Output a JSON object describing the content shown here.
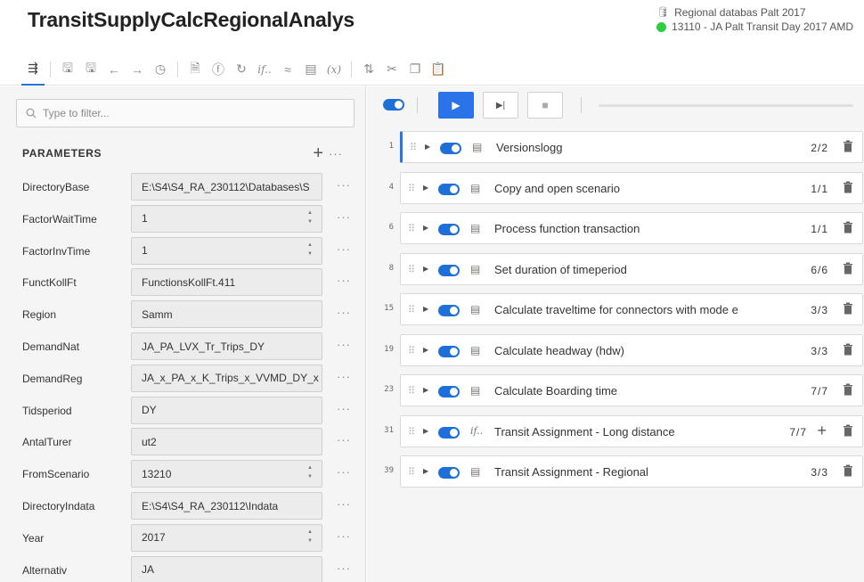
{
  "app": {
    "title": "TransitSupplyCalcRegionalAnalys",
    "database_label": "Regional databas Palt 2017",
    "scenario_label": "13110 - JA Palt Transit Day 2017 AMD",
    "scenario_status_color": "#2ecc40"
  },
  "toolbar": {
    "items": [
      {
        "name": "parameters-tab-icon",
        "glyph": "⇶"
      },
      {
        "name": "save-icon",
        "glyph": "🖫"
      },
      {
        "name": "save-as-icon",
        "glyph": "🖫"
      },
      {
        "name": "undo-icon",
        "glyph": "←"
      },
      {
        "name": "redo-icon",
        "glyph": "→"
      },
      {
        "name": "history-icon",
        "glyph": "◷"
      },
      {
        "name": "document-icon",
        "glyph": "🗎"
      },
      {
        "name": "function-icon",
        "glyph": "ⓕ"
      },
      {
        "name": "refresh-icon",
        "glyph": "↻"
      },
      {
        "name": "conditional-icon",
        "glyph": "if.."
      },
      {
        "name": "loop-icon",
        "glyph": "≈"
      },
      {
        "name": "list-icon",
        "glyph": "▤"
      },
      {
        "name": "variable-icon",
        "glyph": "(x)"
      },
      {
        "name": "sort-icon",
        "glyph": "⇅"
      },
      {
        "name": "cut-icon",
        "glyph": "✂"
      },
      {
        "name": "copy-icon",
        "glyph": "❐"
      },
      {
        "name": "paste-icon",
        "glyph": "📋"
      }
    ]
  },
  "filter": {
    "placeholder": "Type to filter..."
  },
  "parameters": {
    "title": "PARAMETERS",
    "add_glyph": "+",
    "more_glyph": "···",
    "rows": [
      {
        "label": "DirectoryBase",
        "value": "E:\\S4\\S4_RA_230112\\Databases\\S",
        "spinner": false
      },
      {
        "label": "FactorWaitTime",
        "value": "1",
        "spinner": true
      },
      {
        "label": "FactorInvTime",
        "value": "1",
        "spinner": true
      },
      {
        "label": "FunctKollFt",
        "value": "FunctionsKollFt.411",
        "spinner": false
      },
      {
        "label": "Region",
        "value": "Samm",
        "spinner": false
      },
      {
        "label": "DemandNat",
        "value": "JA_PA_LVX_Tr_Trips_DY",
        "spinner": false
      },
      {
        "label": "DemandReg",
        "value": "JA_x_PA_x_K_Trips_x_VVMD_DY_x",
        "spinner": false
      },
      {
        "label": "Tidsperiod",
        "value": "DY",
        "spinner": false
      },
      {
        "label": "AntalTurer",
        "value": "ut2",
        "spinner": false
      },
      {
        "label": "FromScenario",
        "value": "13210",
        "spinner": true
      },
      {
        "label": "DirectoryIndata",
        "value": "E:\\S4\\S4_RA_230112\\Indata",
        "spinner": false
      },
      {
        "label": "Year",
        "value": "2017",
        "spinner": true
      },
      {
        "label": "Alternativ",
        "value": "JA",
        "spinner": false
      }
    ]
  },
  "run_controls": {
    "play_glyph": "▶",
    "step_glyph": "▶|",
    "stop_glyph": "■",
    "progress": 0
  },
  "steps": [
    {
      "num": "1",
      "name": "Versionslogg",
      "count": "2/2",
      "icon": "▤",
      "type": "list",
      "selected": true,
      "plus": false
    },
    {
      "num": "4",
      "name": "Copy and open scenario",
      "count": "1/1",
      "icon": "▤",
      "type": "list",
      "selected": false,
      "plus": false
    },
    {
      "num": "6",
      "name": "Process function transaction",
      "count": "1/1",
      "icon": "▤",
      "type": "list",
      "selected": false,
      "plus": false
    },
    {
      "num": "8",
      "name": "Set duration of timeperiod",
      "count": "6/6",
      "icon": "▤",
      "type": "list",
      "selected": false,
      "plus": false
    },
    {
      "num": "15",
      "name": "Calculate traveltime for connectors with mode e",
      "count": "3/3",
      "icon": "▤",
      "type": "list",
      "selected": false,
      "plus": false
    },
    {
      "num": "19",
      "name": "Calculate headway (hdw)",
      "count": "3/3",
      "icon": "▤",
      "type": "list",
      "selected": false,
      "plus": false
    },
    {
      "num": "23",
      "name": "Calculate Boarding time",
      "count": "7/7",
      "icon": "▤",
      "type": "list",
      "selected": false,
      "plus": false
    },
    {
      "num": "31",
      "name": "Transit Assignment - Long distance",
      "count": "7/7",
      "icon": "if..",
      "type": "conditional",
      "selected": false,
      "plus": true
    },
    {
      "num": "39",
      "name": "Transit Assignment - Regional",
      "count": "3/3",
      "icon": "▤",
      "type": "list",
      "selected": false,
      "plus": false
    }
  ],
  "colors": {
    "accent": "#2a73e8",
    "toggle_on": "#1f6fd8",
    "panel_bg": "#f5f5f5"
  }
}
